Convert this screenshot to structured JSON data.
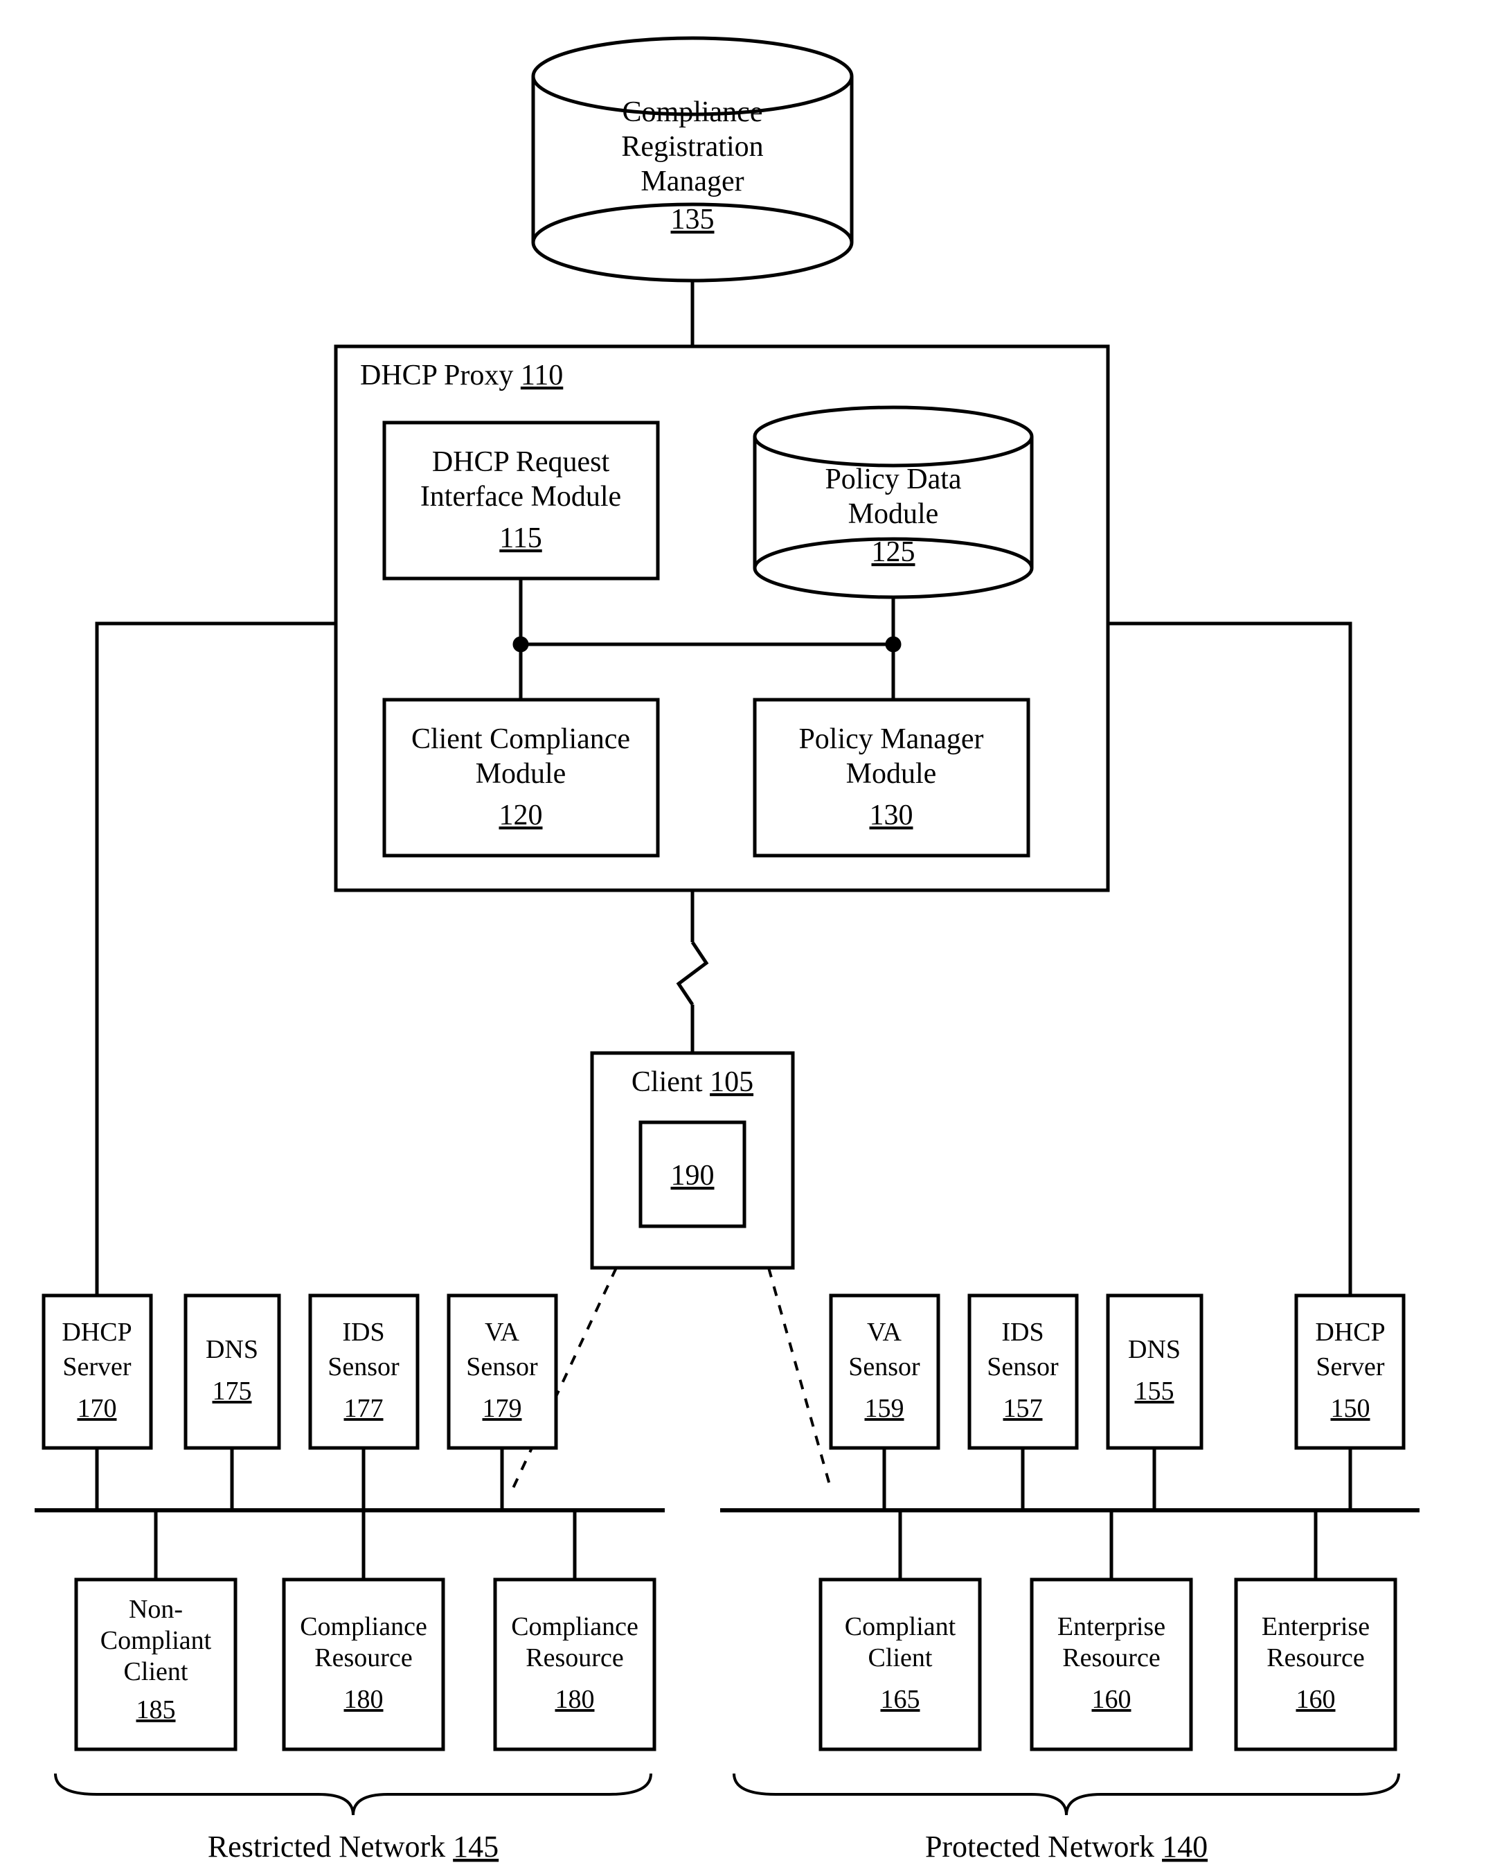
{
  "crm": {
    "l1": "Compliance",
    "l2": "Registration",
    "l3": "Manager",
    "num": "135"
  },
  "proxy": {
    "title": "DHCP Proxy",
    "num": "110"
  },
  "dhcpReq": {
    "l1": "DHCP Request",
    "l2": "Interface Module",
    "num": "115"
  },
  "policyData": {
    "l1": "Policy Data",
    "l2": "Module",
    "num": "125"
  },
  "clientComp": {
    "l1": "Client Compliance",
    "l2": "Module",
    "num": "120"
  },
  "policyMgr": {
    "l1": "Policy Manager",
    "l2": "Module",
    "num": "130"
  },
  "client": {
    "title": "Client",
    "num": "105",
    "inner": "190"
  },
  "left": {
    "dhcp": {
      "l1": "DHCP",
      "l2": "Server",
      "num": "170"
    },
    "dns": {
      "l1": "DNS",
      "num": "175"
    },
    "ids": {
      "l1": "IDS",
      "l2": "Sensor",
      "num": "177"
    },
    "va": {
      "l1": "VA",
      "l2": "Sensor",
      "num": "179"
    }
  },
  "right": {
    "va": {
      "l1": "VA",
      "l2": "Sensor",
      "num": "159"
    },
    "ids": {
      "l1": "IDS",
      "l2": "Sensor",
      "num": "157"
    },
    "dns": {
      "l1": "DNS",
      "num": "155"
    },
    "dhcp": {
      "l1": "DHCP",
      "l2": "Server",
      "num": "150"
    }
  },
  "lb": {
    "ncc": {
      "l1": "Non-",
      "l2": "Compliant",
      "l3": "Client",
      "num": "185"
    },
    "cr1": {
      "l1": "Compliance",
      "l2": "Resource",
      "num": "180"
    },
    "cr2": {
      "l1": "Compliance",
      "l2": "Resource",
      "num": "180"
    }
  },
  "rb": {
    "cc": {
      "l1": "Compliant",
      "l2": "Client",
      "num": "165"
    },
    "er1": {
      "l1": "Enterprise",
      "l2": "Resource",
      "num": "160"
    },
    "er2": {
      "l1": "Enterprise",
      "l2": "Resource",
      "num": "160"
    }
  },
  "nets": {
    "restricted": "Restricted Network",
    "restrictedNum": "145",
    "protected": "Protected Network",
    "protectedNum": "140"
  }
}
